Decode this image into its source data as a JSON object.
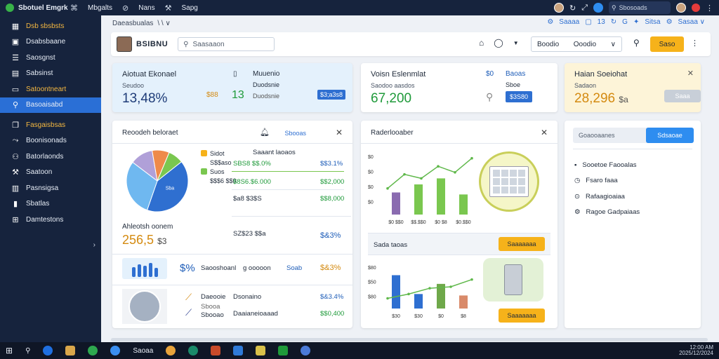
{
  "topbar": {
    "app_title": "Sbotuel Emgrk",
    "nav": [
      {
        "icon": "grid-icon",
        "glyph": "⌘",
        "label": ""
      },
      {
        "icon": "",
        "glyph": "",
        "label": "Mbgalts"
      },
      {
        "icon": "link-icon",
        "glyph": "⊘",
        "label": ""
      },
      {
        "icon": "",
        "glyph": "",
        "label": "Nans"
      },
      {
        "icon": "tools-icon",
        "glyph": "⚒",
        "label": ""
      },
      {
        "icon": "",
        "glyph": "",
        "label": "Sapg"
      }
    ],
    "search_placeholder": "Sbosoads"
  },
  "sidebar": {
    "items": [
      {
        "label": "Dsb sbsbsts",
        "icon": "grid-icon",
        "glyph": "▦",
        "gold": true
      },
      {
        "label": "Dsabsbaane",
        "icon": "folder-icon",
        "glyph": "▣",
        "gold": false
      },
      {
        "label": "Saosgnst",
        "icon": "list-icon",
        "glyph": "☰",
        "gold": false
      },
      {
        "label": "Sabsinst",
        "icon": "calendar-icon",
        "glyph": "▤",
        "gold": false
      },
      {
        "label": "Satoontneart",
        "icon": "inbox-icon",
        "glyph": "▭",
        "gold": true
      },
      {
        "label": "Basoaisabd",
        "icon": "search-icon",
        "glyph": "⚲",
        "gold": false,
        "active": true
      },
      {
        "label": "Fasgaisbsas",
        "icon": "copy-icon",
        "glyph": "❐",
        "gold": true,
        "gap": true
      },
      {
        "label": "Boonisonads",
        "icon": "share-icon",
        "glyph": "⤳",
        "gold": false
      },
      {
        "label": "Batorlaonds",
        "icon": "users-icon",
        "glyph": "⚇",
        "gold": false
      },
      {
        "label": "Saatoon",
        "icon": "wrench-icon",
        "glyph": "⚒",
        "gold": false
      },
      {
        "label": "Pasnsigsa",
        "icon": "layout-icon",
        "glyph": "▥",
        "gold": false
      },
      {
        "label": "Sbatlas",
        "icon": "chart-icon",
        "glyph": "▮",
        "gold": false
      },
      {
        "label": "Damtestons",
        "icon": "table-icon",
        "glyph": "⊞",
        "gold": false
      }
    ]
  },
  "breadcrumb": {
    "text": "Daeasbualas",
    "sep": "\\ \\ ∨",
    "right": [
      {
        "icon": "gear-icon",
        "glyph": "⚙",
        "label": "Saaaa"
      },
      {
        "icon": "badge-icon",
        "glyph": "▢",
        "label": "13"
      },
      {
        "icon": "refresh-icon",
        "glyph": "↻",
        "label": "G"
      },
      {
        "icon": "star-icon",
        "glyph": "✦",
        "label": "Sitsa"
      },
      {
        "icon": "gear-icon",
        "glyph": "⚙",
        "label": "Sasaa ∨"
      }
    ]
  },
  "toolbar": {
    "title": "BSIBNU",
    "search_placeholder": "Saasaaon",
    "select_left": "Boodio",
    "select_right": "Ooodio",
    "button_label": "Saso",
    "more_glyph": "⋮⃞"
  },
  "kpis": [
    {
      "title": "Aiotuat Ekonael",
      "sub": "Seudoo",
      "value": "13,48%",
      "mid_icon": "phone-icon",
      "mid_glyph": "▯",
      "mid_label": "Muuenio",
      "mid_sub": "Duodsnie",
      "mid_num": "13",
      "mid_badge_left": "$88",
      "badge": "$3;a3s8"
    },
    {
      "title": "Voisn Eslenmlat",
      "sub": "Saodoo aasdos",
      "value": "67,200",
      "mid_icon": "plug-icon",
      "mid_glyph": "⚲",
      "mid_label": "Baoas",
      "mid_sub": "Sboe",
      "mid_num": "$0",
      "badge": "$3S80"
    },
    {
      "title": "Haian Soeiohat",
      "sub": "Sadaon",
      "value": "28,296",
      "value_suffix": "$a",
      "button": "Saaa"
    }
  ],
  "panelA": {
    "title": "Reoodeh beloraet",
    "link": "Sbooas",
    "legend": [
      {
        "color": "#f6b21a",
        "label": "Sidot"
      },
      {
        "color": "",
        "label": "S$$aso"
      },
      {
        "color": "#7ac74f",
        "label": "Suos"
      },
      {
        "color": "",
        "label": "$$$6 $$0"
      }
    ],
    "pie_slices": [
      {
        "label": "Sba",
        "value": 41,
        "color": "#2f6fd0"
      },
      {
        "label": "",
        "value": 30,
        "color": "#6fb8f0"
      },
      {
        "label": "",
        "value": 12,
        "color": "#b0a0d8"
      },
      {
        "label": "",
        "value": 9,
        "color": "#ee8a4a"
      },
      {
        "label": "",
        "value": 8,
        "color": "#7ac74f"
      }
    ],
    "rows": [
      {
        "a": "Saaant laoaos",
        "b": "",
        "c": ""
      },
      {
        "a": "SBS8 $$.0%",
        "b": "",
        "c": "$$3.1%"
      },
      {
        "a": "$8S6.$6.000",
        "b": "",
        "c": "$$2,000"
      },
      {
        "a": "$a8 $3$S",
        "b": "",
        "c": "$$8,000"
      }
    ],
    "metric_title": "Ahleotsh oonem",
    "metric_value": "256,5",
    "metric_suffix": "$3",
    "metric_row_label": "SZ$23 $$a",
    "metric_row_value": "$&3%",
    "people_pct": "$%",
    "people_label": "Saooshoanl",
    "people_label2": "g ooooon",
    "people_link": "Soab",
    "people_value": "$&3%",
    "person_rows": [
      {
        "icon": "arrow-icon",
        "glyph": "⟋",
        "a": "Daeooie",
        "b": "Dsonaino",
        "value": "$&3.4%"
      },
      {
        "icon": "",
        "glyph": "",
        "a": "Sbooa",
        "b": "",
        "value": ""
      },
      {
        "icon": "arrow-icon",
        "glyph": "⟋",
        "a": "Sbooao",
        "b": "Daaianeioaaad",
        "value": "$$0,400"
      }
    ]
  },
  "panelB": {
    "title": "Raderlooaber",
    "chart1": {
      "type": "bar",
      "categories": [
        "$0 $$0",
        "$$.$$0",
        "$0 $8",
        "$0.$$0"
      ],
      "values": [
        11,
        15,
        18,
        10
      ],
      "line": [
        13,
        20,
        18,
        24,
        21,
        28
      ],
      "ylabels": [
        "$0",
        "$0",
        "$0",
        "$0"
      ],
      "ylim": [
        0,
        30
      ]
    },
    "subhead": "Sada taoas",
    "button1": "Saaaaaaa",
    "chart2": {
      "type": "bar",
      "categories": [
        "$30",
        "$30",
        "$0",
        "$8"
      ],
      "values": [
        23,
        10,
        17,
        9
      ],
      "line": [
        7,
        10,
        14,
        15,
        20
      ],
      "ylabels": [
        "$80",
        "$50",
        "$80"
      ],
      "ylim": [
        0,
        30
      ]
    },
    "button2": "Saaaaaaa"
  },
  "panelC": {
    "input_placeholder": "Goaooaanes",
    "button": "Sdsaoae",
    "items": [
      {
        "icon": "list-icon",
        "glyph": "▪",
        "label": "Sooetoe Faooalas"
      },
      {
        "icon": "clock-icon",
        "glyph": "◷",
        "label": "Fsaro faaa"
      },
      {
        "icon": "badge-icon",
        "glyph": "⊙",
        "label": "Rafaagioaiaa"
      },
      {
        "icon": "gear-icon",
        "glyph": "⚙",
        "label": "Ragoe Gadpaiaas"
      }
    ]
  },
  "taskbar": {
    "label": "Saoaa",
    "tray_time": "12:00 AM",
    "tray_date": "2025/12/2024"
  },
  "colors": {
    "accent": "#2e8df0",
    "warning": "#f6b21a",
    "success": "#1f9a3a",
    "sidebar": "#16233d"
  }
}
